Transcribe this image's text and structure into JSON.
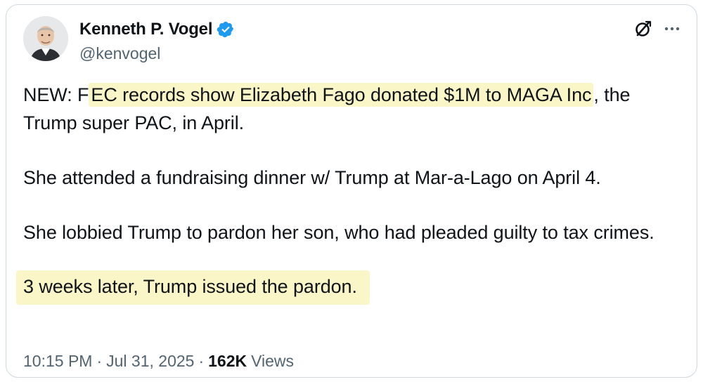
{
  "author": {
    "display_name": "Kenneth P. Vogel",
    "handle": "@kenvogel",
    "verified": true,
    "avatar_icon": "avatar-photo"
  },
  "header_actions": {
    "grok_icon": "grok-icon",
    "more_icon": "more-options-icon"
  },
  "tweet": {
    "p1_prefix": "NEW: F",
    "p1_highlight": "EC records show Elizabeth Fago donated $1M to MAGA Inc",
    "p1_suffix": ", the Trump super PAC, in April.",
    "p2": "She attended a fundraising dinner w/ Trump at Mar-a-Lago on April 4.",
    "p3": "She lobbied Trump to pardon her son, who had pleaded guilty to tax crimes.",
    "p4_highlight": "3 weeks later, Trump issued the pardon."
  },
  "meta": {
    "time": "10:15 PM",
    "separator": "·",
    "date": "Jul 31, 2025",
    "views_count": "162K",
    "views_label": "Views"
  },
  "colors": {
    "text": "#0f1419",
    "secondary": "#536471",
    "verified_blue": "#1d9bf0",
    "highlight": "#fbf6c8",
    "border": "#cfd9de"
  }
}
